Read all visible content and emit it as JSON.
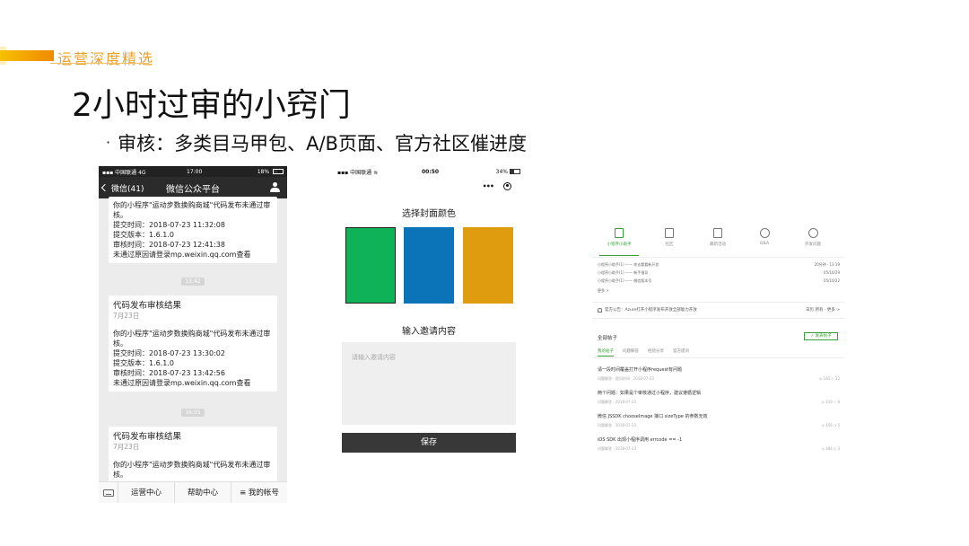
{
  "brand": {
    "text": "运营深度精选"
  },
  "slide": {
    "title": "2小时过审的小窍门",
    "subtitle": "审核：多类目马甲包、A/B页面、官方社区催进度"
  },
  "wechat": {
    "status": {
      "carrier": "中国联通",
      "network": "4G",
      "time": "17:00",
      "battery": "18%"
    },
    "back_label": "微信(41)",
    "title": "微信公众平台",
    "messages": [
      {
        "title": "",
        "date": "",
        "body": "你的小程序\"运动步数换购商城\"代码发布未通过审核。",
        "submit_time": "提交时间：2018-07-23 11:32:08",
        "version": "提交版本：1.6.1.0",
        "review_time": "审核时间：2018-07-23 12:41:38",
        "note": "未通过原因请登录mp.weixin.qq.com查看"
      },
      {
        "title": "代码发布审核结果",
        "date": "7月23日",
        "body": "你的小程序\"运动步数换购商城\"代码发布未通过审核。",
        "submit_time": "提交时间：2018-07-23 13:30:02",
        "version": "提交版本：1.6.1.0",
        "review_time": "审核时间：2018-07-23 13:42:56",
        "note": "未通过原因请登录mp.weixin.qq.com查看"
      },
      {
        "title": "代码发布审核结果",
        "date": "7月23日",
        "body": "你的小程序\"运动步数换购商城\"代码发布未通过审核。"
      }
    ],
    "time_chips": [
      "13:42",
      "16:05"
    ],
    "tabs": [
      "运营中心",
      "帮助中心",
      "≡ 我的帐号"
    ]
  },
  "miniapp": {
    "status": {
      "carrier": "中国联通",
      "time": "00:50",
      "battery": "34%"
    },
    "cover_heading": "选择封面颜色",
    "colors": {
      "green": "#0fb257",
      "blue": "#0b73b8",
      "gold": "#df9c0f"
    },
    "invite_heading": "输入邀请内容",
    "invite_placeholder": "请输入邀请内容",
    "save_label": "保存"
  },
  "community": {
    "nav": [
      "小程序小助手",
      "社区",
      "最新活动",
      "Q&A",
      "开发问题"
    ],
    "notifications": [
      {
        "text": "小程序小助手(1) —— 你去看看新开发",
        "meta": "20分钟 · 13:19"
      },
      {
        "text": "小程序小助手(1) —— 新手指导",
        "meta": "05/10/29"
      },
      {
        "text": "小程序小助手(1) —— 微信版本号",
        "meta": "05/10/22"
      }
    ],
    "more": "更多 >",
    "announcement": "官方公告：Azure打开小程序发布开放全部能力开放",
    "announcement_links": "日历 所有 · 更多 >",
    "section_title": "全部帖子",
    "post_button": "✓ 发表帖子",
    "sub_tabs": [
      "我的帖子",
      "问题解答",
      "经验分享",
      "官方提问"
    ],
    "posts": [
      {
        "title": "请一段时间覆盖打开小程序request有问题",
        "meta": "问题解答 · 提问时间 · 2018-07-23",
        "stats": "◎ 181  ◇ 12"
      },
      {
        "title": "两个问题：如果是个审核通过小程序，建议遵循逻辑",
        "meta": "问题解答 · 2018-07-23",
        "stats": "◎ 219  ◇ 8"
      },
      {
        "title": "微信 JSSDK chooseImage 接口 sizeType 的参数无效",
        "meta": "问题解答 · 2018-07-23",
        "stats": "◎ 456  ◇ 5"
      },
      {
        "title": "iOS SDK 出现小程序调用 errcode == -1",
        "meta": "问题解答 · 2018-07-23",
        "stats": "◎ 484  ◇ 3"
      }
    ]
  }
}
